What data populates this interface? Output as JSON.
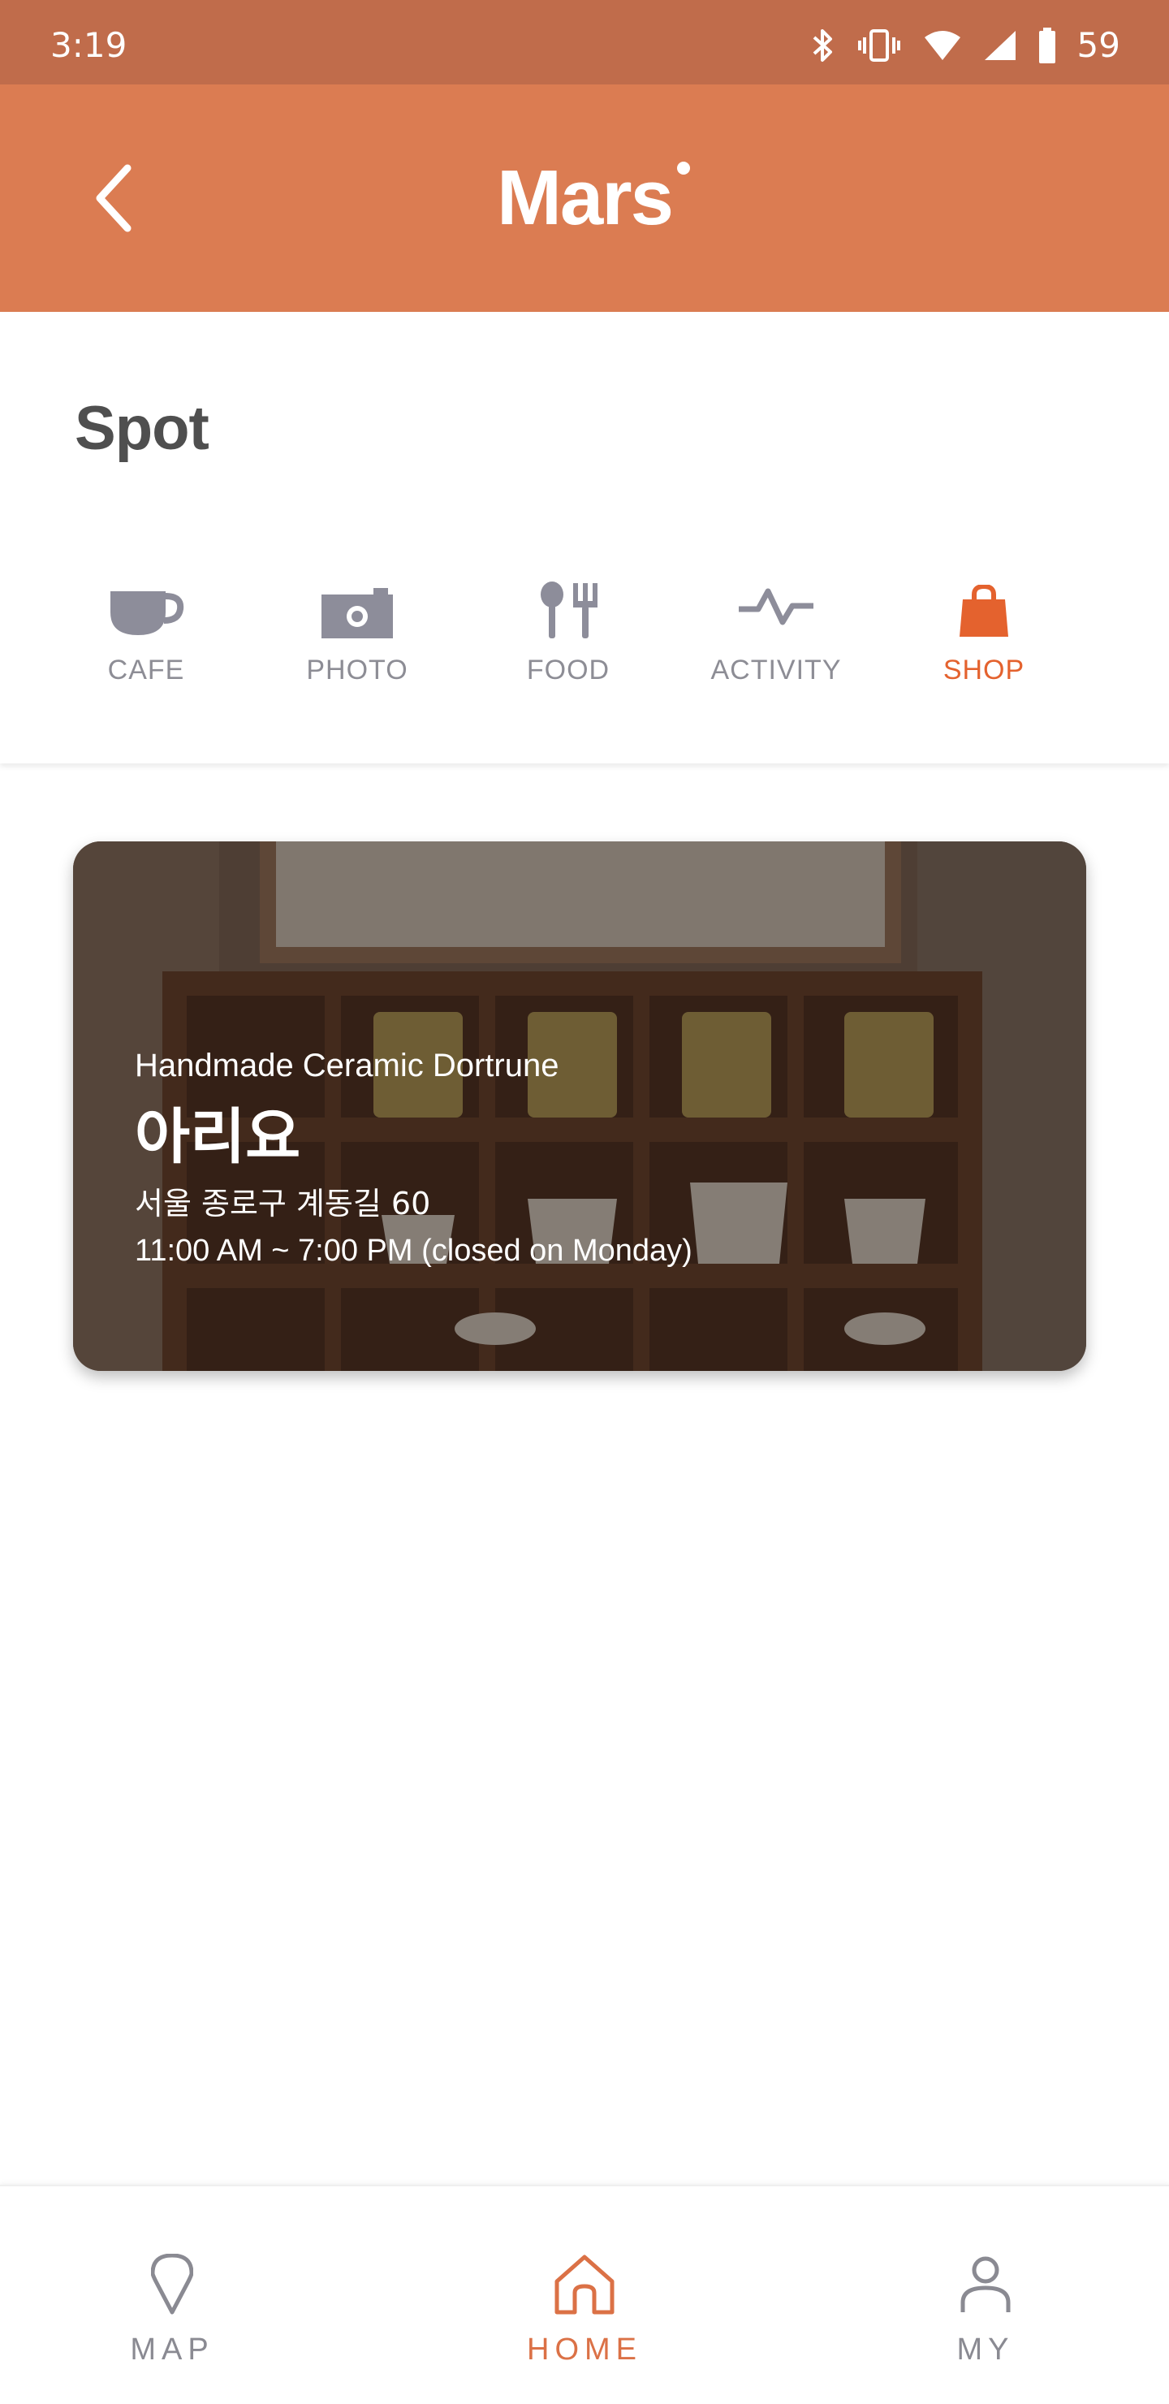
{
  "status_bar": {
    "time": "3:19",
    "battery": "59",
    "icons": [
      "bluetooth-icon",
      "vibrate-icon",
      "wifi-icon",
      "signal-icon",
      "battery-icon"
    ]
  },
  "app_bar": {
    "title": "Mars",
    "back_icon": "chevron-left-icon",
    "background": "#db7c52"
  },
  "spot": {
    "heading": "Spot",
    "categories": [
      {
        "label": "CAFE",
        "icon": "coffee-cup-icon",
        "active": false
      },
      {
        "label": "PHOTO",
        "icon": "camera-icon",
        "active": false
      },
      {
        "label": "FOOD",
        "icon": "fork-spoon-icon",
        "active": false
      },
      {
        "label": "ACTIVITY",
        "icon": "pulse-icon",
        "active": false
      },
      {
        "label": "SHOP",
        "icon": "shopping-bag-icon",
        "active": true
      }
    ],
    "active_color": "#e4622e",
    "inactive_color": "#8d8d95"
  },
  "card": {
    "category": "Handmade Ceramic Dortrune",
    "name": "아리요",
    "address": "서울 종로구 계동길 60",
    "hours": "11:00 AM ~ 7:00 PM (closed on Monday)"
  },
  "bottom_nav": {
    "items": [
      {
        "label": "MAP",
        "icon": "map-pin-icon",
        "active": false
      },
      {
        "label": "HOME",
        "icon": "home-icon",
        "active": true
      },
      {
        "label": "MY",
        "icon": "person-icon",
        "active": false
      }
    ],
    "active_color": "#db7146"
  }
}
